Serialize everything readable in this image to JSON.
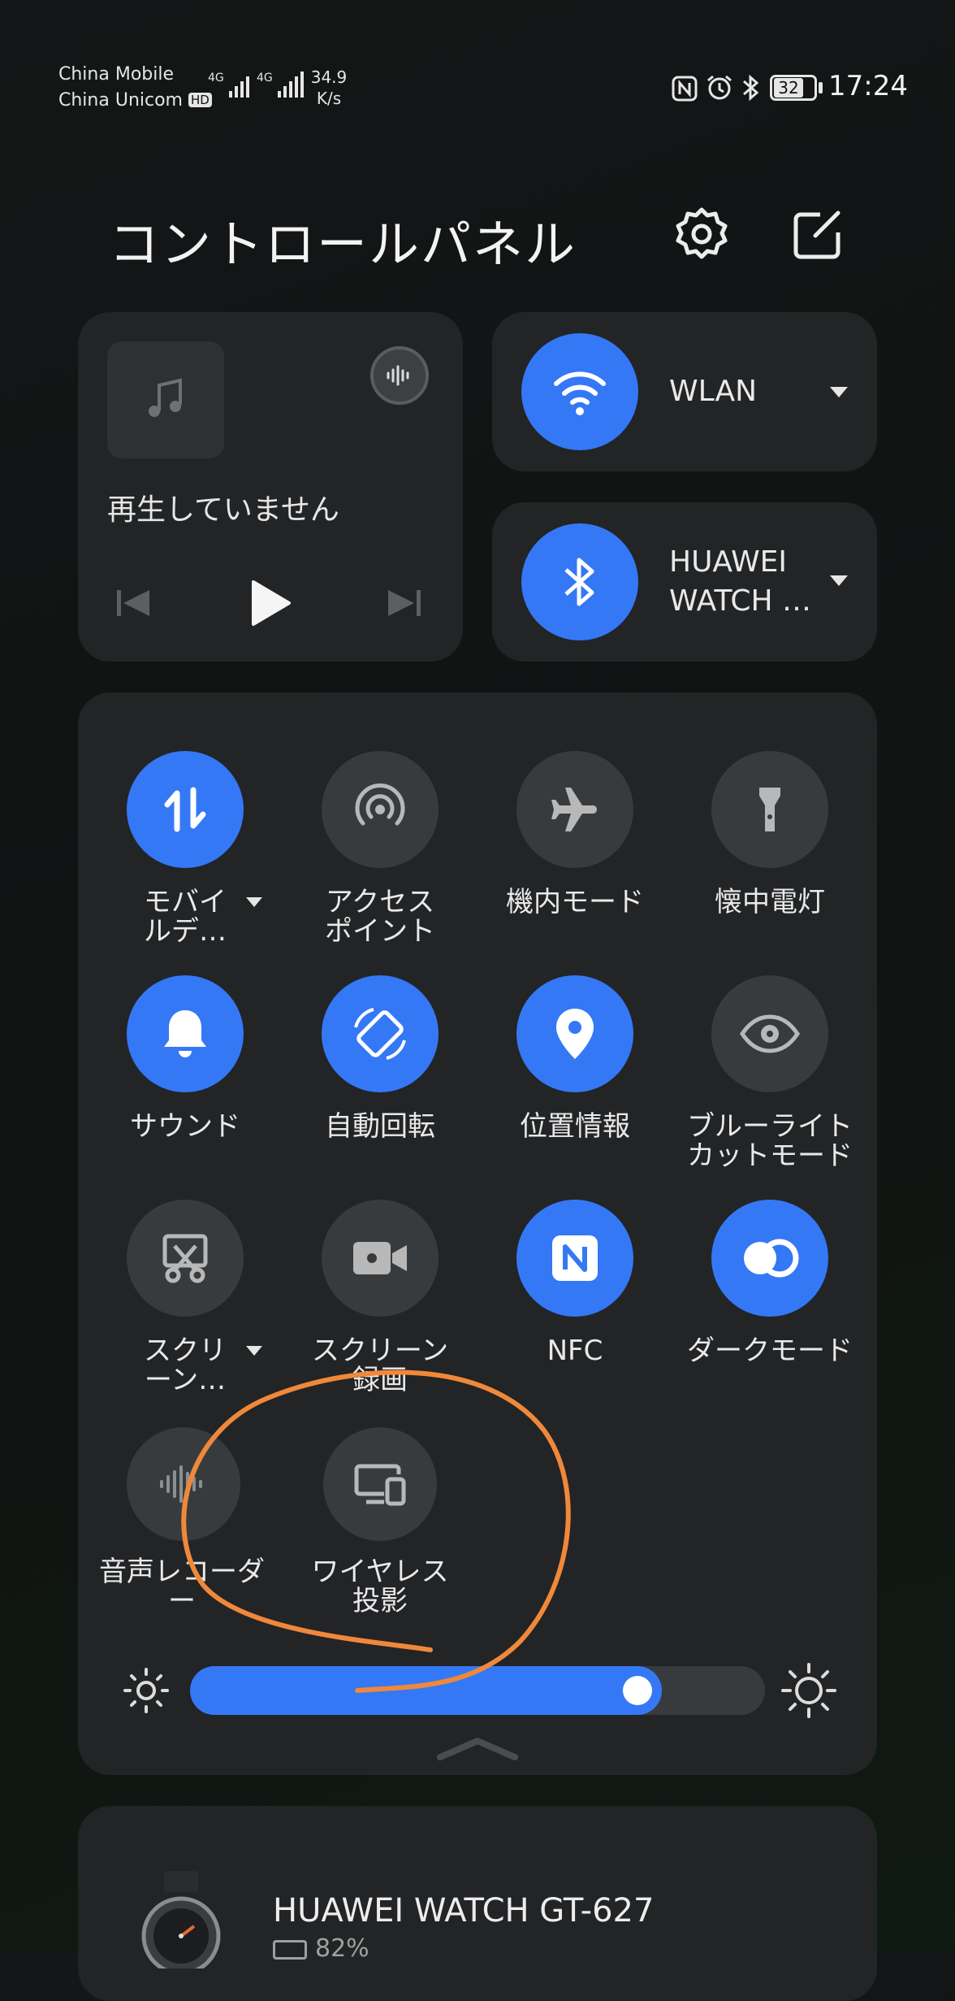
{
  "status": {
    "carrier1": "China Mobile",
    "carrier2": "China Unicom",
    "hd": "HD",
    "net1": "4G",
    "net2": "4G",
    "speed_value": "34.9",
    "speed_unit": "K/s",
    "battery": "32",
    "time": "17:24"
  },
  "header": {
    "title": "コントロールパネル"
  },
  "media": {
    "status": "再生していません"
  },
  "wlan": {
    "label": "WLAN"
  },
  "bluetooth": {
    "label_line1": "HUAWEI",
    "label_line2": "WATCH …"
  },
  "tiles": [
    {
      "l1": "モバイ",
      "l2": "ルデ…"
    },
    {
      "l1": "アクセス",
      "l2": "ポイント"
    },
    {
      "l1": "機内モード"
    },
    {
      "l1": "懐中電灯"
    },
    {
      "l1": "サウンド"
    },
    {
      "l1": "自動回転"
    },
    {
      "l1": "位置情報"
    },
    {
      "l1": "ブルーライト",
      "l2": "カットモード"
    },
    {
      "l1": "スクリ",
      "l2": "ーン…"
    },
    {
      "l1": "スクリーン",
      "l2": "録画"
    },
    {
      "l1": "NFC"
    },
    {
      "l1": "ダークモード"
    },
    {
      "l1": "音声レコーダ",
      "l2": "ー"
    },
    {
      "l1": "ワイヤレス",
      "l2": "投影"
    }
  ],
  "brightness": {
    "level": 0.82
  },
  "device": {
    "name": "HUAWEI WATCH GT-627",
    "battery": "82%"
  },
  "colors": {
    "accent": "#3478f6",
    "annotation": "#f0883a"
  }
}
